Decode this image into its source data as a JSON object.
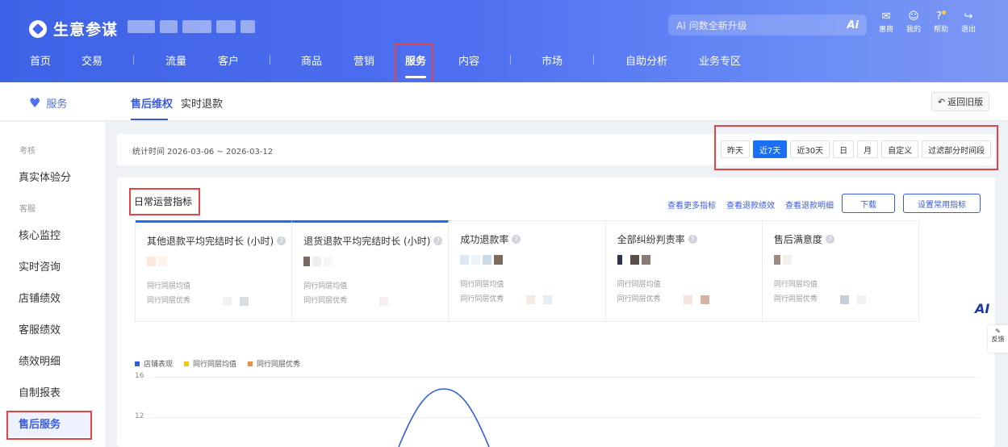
{
  "header": {
    "logo_text": "生意参谋",
    "ai_search_placeholder": "AI 问数全新升级",
    "ai_icon_text": "Ai",
    "icons": [
      {
        "label": "惠商",
        "icon": "message-icon"
      },
      {
        "label": "我的",
        "icon": "user-icon"
      },
      {
        "label": "帮助",
        "icon": "help-icon"
      },
      {
        "label": "退出",
        "icon": "logout-icon"
      }
    ]
  },
  "nav": {
    "items": [
      "首页",
      "交易",
      "流量",
      "客户",
      "商品",
      "营销",
      "服务",
      "内容",
      "市场",
      "自助分析",
      "业务专区"
    ],
    "active": "服务"
  },
  "subheader": {
    "section_title": "服务",
    "tabs": [
      "售后维权",
      "实时退款"
    ],
    "active_tab": "售后维权",
    "back_old_label": "返回旧版"
  },
  "sidebar": {
    "groups": [
      {
        "label": "考核",
        "items": [
          "真实体验分"
        ]
      },
      {
        "label": "客服",
        "items": [
          "核心监控",
          "实时咨询",
          "店铺绩效",
          "客服绩效",
          "绩效明细",
          "自制报表",
          "售后服务"
        ]
      }
    ],
    "active": "售后服务"
  },
  "time_filter": {
    "stat_time": "统计时间 2026-03-06 ~ 2026-03-12",
    "buttons": [
      "昨天",
      "近7天",
      "近30天",
      "日",
      "月",
      "自定义",
      "过滤部分时间段"
    ],
    "active": "近7天"
  },
  "metrics": {
    "title": "日常运营指标",
    "links": [
      "查看更多指标",
      "查看退款绩效",
      "查看退款明细"
    ],
    "download_label": "下载",
    "settings_label": "设置常用指标",
    "kpis": [
      {
        "name": "其他退款平均完结时长 (小时)",
        "avg_label": "同行同层均值",
        "best_label": "同行同层优秀"
      },
      {
        "name": "退货退款平均完结时长 (小时)",
        "avg_label": "同行同层均值",
        "best_label": "同行同层优秀"
      },
      {
        "name": "成功退款率",
        "avg_label": "同行同层均值",
        "best_label": "同行同层优秀"
      },
      {
        "name": "全部纠纷判责率",
        "avg_label": "同行同层均值",
        "best_label": "同行同层优秀"
      },
      {
        "name": "售后满意度",
        "avg_label": "同行同层均值",
        "best_label": "同行同层优秀"
      }
    ]
  },
  "chart": {
    "legend": [
      {
        "name": "店铺表现",
        "color": "#2f5fe0"
      },
      {
        "name": "同行同层均值",
        "color": "#f5c518"
      },
      {
        "name": "同行同层优秀",
        "color": "#f08a3c"
      }
    ],
    "y_ticks": [
      "16",
      "12"
    ]
  },
  "floating": {
    "ai_badge": "AI",
    "feedback_label": "反馈"
  }
}
